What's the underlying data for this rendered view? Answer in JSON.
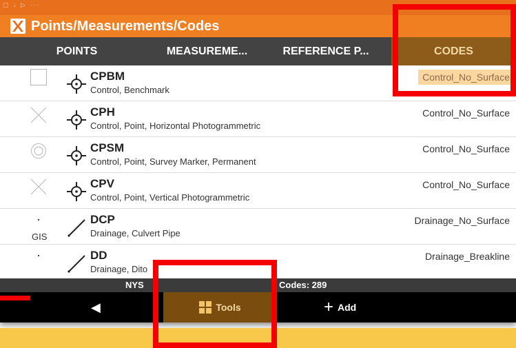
{
  "app": {
    "title": "Points/Measurements/Codes",
    "logo_icon": "app-logo-icon",
    "accent": "#f07f22"
  },
  "status_bar": {
    "icons": "▢ ↓ ▷ ···"
  },
  "tabs": [
    {
      "label": "POINTS",
      "active": false
    },
    {
      "label": "MEASUREME...",
      "active": false
    },
    {
      "label": "REFERENCE P...",
      "active": false
    },
    {
      "label": "CODES",
      "active": true
    }
  ],
  "codes": [
    {
      "code": "CPBM",
      "description": "Control, Benchmark",
      "surface": "Control_No_Surface",
      "marker": "checkbox",
      "symbol": "control-point-symbol",
      "gis": "",
      "selected": true
    },
    {
      "code": "CPH",
      "description": "Control, Point, Horizontal Photogrammetric",
      "surface": "Control_No_Surface",
      "marker": "cross",
      "symbol": "control-point-symbol",
      "gis": "",
      "selected": false
    },
    {
      "code": "CPSM",
      "description": "Control, Point, Survey Marker, Permanent",
      "surface": "Control_No_Surface",
      "marker": "double-circle",
      "symbol": "control-point-symbol",
      "gis": "",
      "selected": false
    },
    {
      "code": "CPV",
      "description": "Control, Point, Vertical Photogrammetric",
      "surface": "Control_No_Surface",
      "marker": "cross",
      "symbol": "control-point-symbol",
      "gis": "",
      "selected": false
    },
    {
      "code": "DCP",
      "description": "Drainage, Culvert Pipe",
      "surface": "Drainage_No_Surface",
      "marker": "dot",
      "symbol": "line-symbol",
      "gis": "GIS",
      "selected": false
    },
    {
      "code": "DD",
      "description": "Drainage, Dito",
      "surface": "Drainage_Breakline",
      "marker": "dot",
      "symbol": "line-symbol",
      "gis": "",
      "selected": false
    }
  ],
  "info_bar": {
    "project": "NYS",
    "codes_count": "Codes: 289"
  },
  "bottom_bar": {
    "back_icon": "back-arrow-icon",
    "tools_label": "Tools",
    "add_label": "Add"
  },
  "annotations": {
    "highlight_color": "#f40000"
  }
}
